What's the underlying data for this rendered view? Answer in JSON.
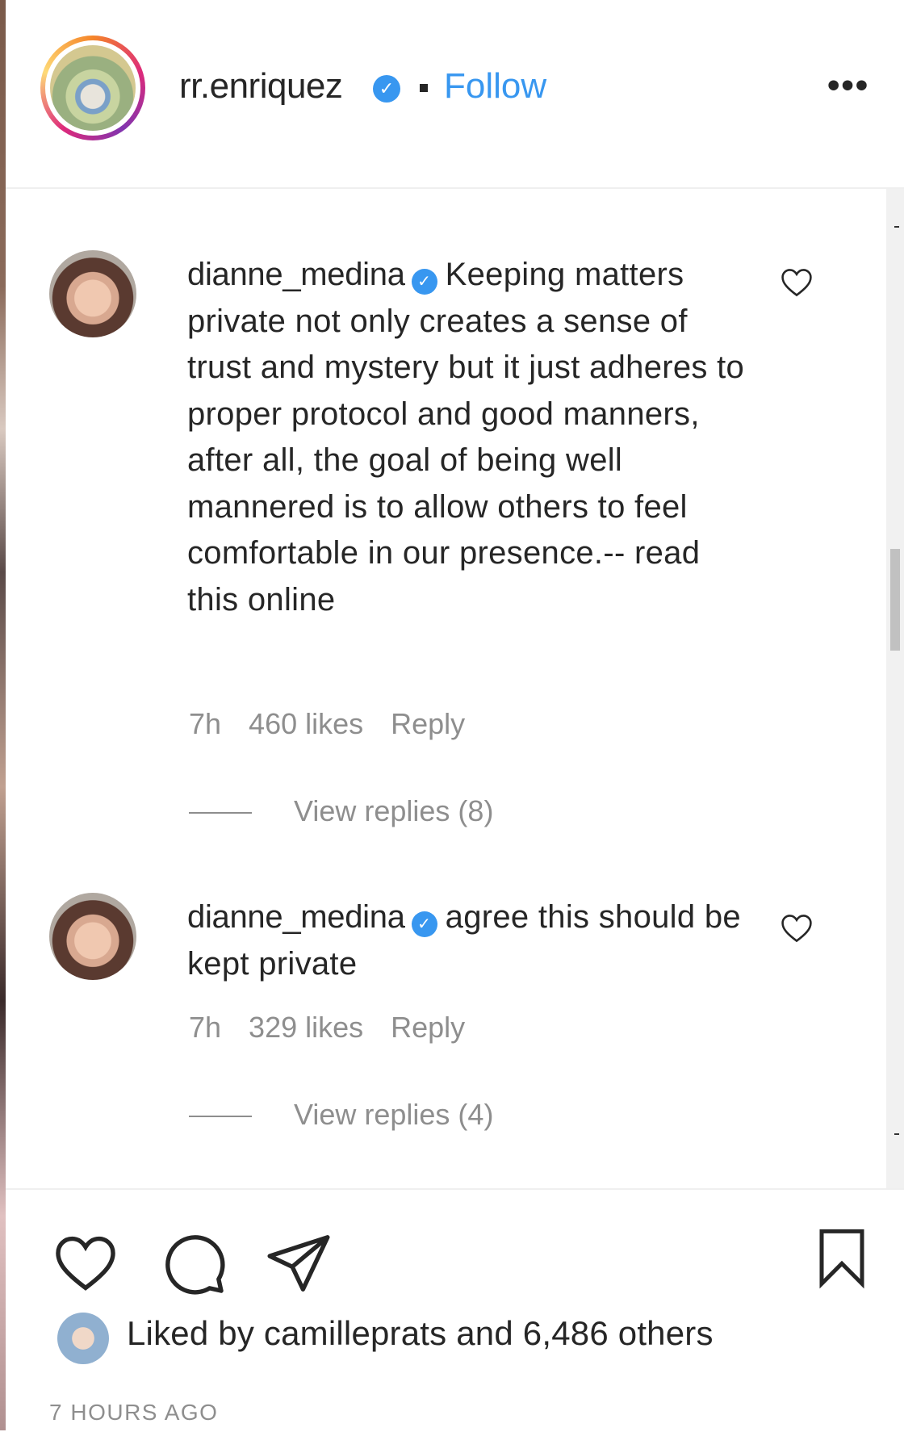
{
  "header": {
    "username": "rr.enriquez",
    "verified_glyph": "✓",
    "separator": "•",
    "follow_label": "Follow",
    "more_label": "•••"
  },
  "comments": [
    {
      "username": "dianne_medina",
      "verified_glyph": "✓",
      "text": "Keeping matters private not only creates a sense of trust and mystery but it just adheres to proper protocol and good manners, after all, the goal of being well mannered is to allow others to feel comfortable in our presence.-- read this online",
      "time": "7h",
      "likes": "460 likes",
      "reply_label": "Reply",
      "view_replies": "View replies (8)"
    },
    {
      "username": "dianne_medina",
      "verified_glyph": "✓",
      "text": "agree this should be kept private",
      "time": "7h",
      "likes": "329 likes",
      "reply_label": "Reply",
      "view_replies": "View replies (4)"
    }
  ],
  "footer": {
    "liked_by": "Liked by camilleprats and 6,486 others",
    "time_ago": "7 HOURS AGO"
  },
  "icons": {
    "like": "heart-icon",
    "comment": "comment-bubble-icon",
    "share": "paper-plane-icon",
    "save": "bookmark-icon",
    "comment_like": "heart-outline-icon",
    "more": "more-dots-icon"
  },
  "colors": {
    "accent": "#3897f0",
    "text": "#262626",
    "muted": "#8e8e8e"
  }
}
